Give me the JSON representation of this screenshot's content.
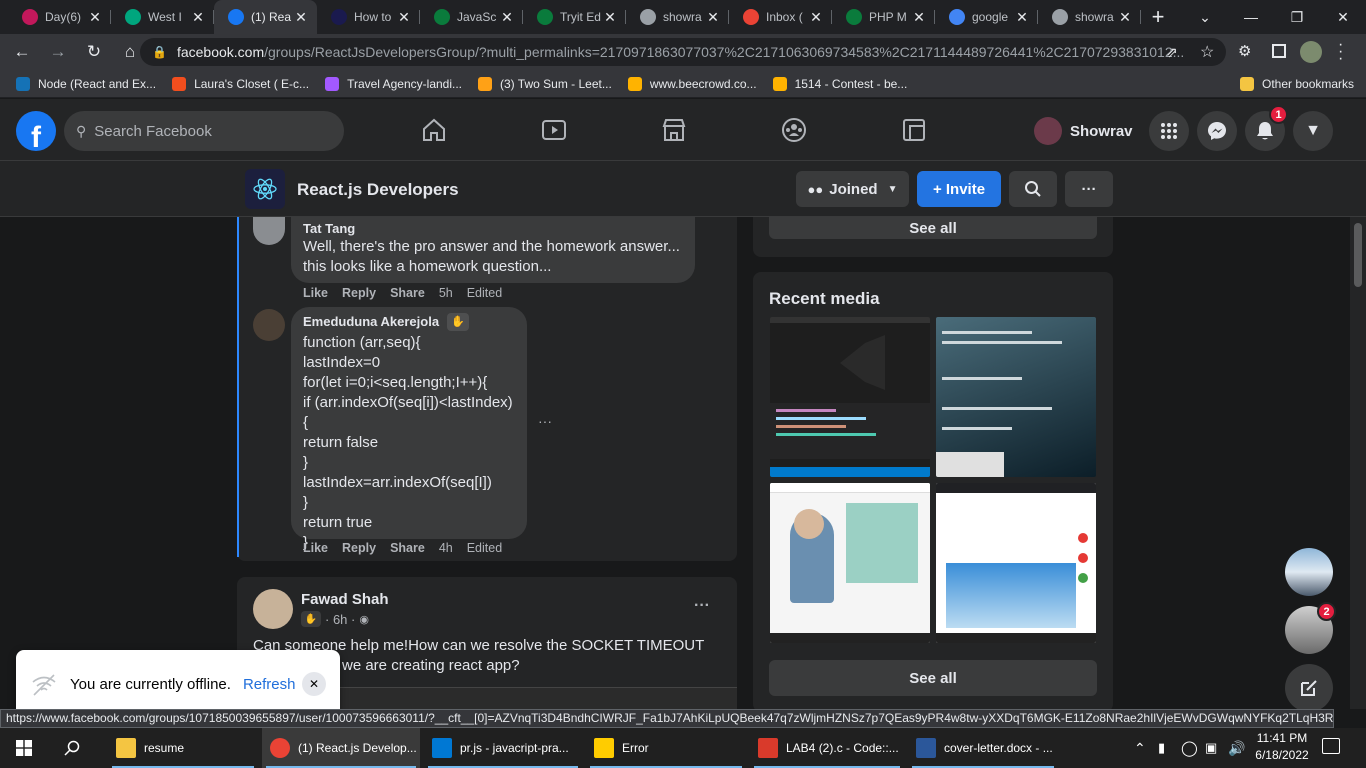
{
  "browser": {
    "tabs": [
      {
        "title": "Day(6)",
        "favicon_color": "#c2185b",
        "active": false
      },
      {
        "title": "West I",
        "favicon_color": "#00a67e",
        "active": false
      },
      {
        "title": "(1) Rea",
        "favicon_color": "#1877f2",
        "active": true
      },
      {
        "title": "How to",
        "favicon_color": "#1a1a4e",
        "active": false
      },
      {
        "title": "JavaSc",
        "favicon_color": "#0a7b3c",
        "active": false
      },
      {
        "title": "Tryit Ed",
        "favicon_color": "#0a7b3c",
        "active": false
      },
      {
        "title": "showra",
        "favicon_color": "#9aa0a6",
        "active": false
      },
      {
        "title": "Inbox (",
        "favicon_color": "#ea4335",
        "active": false
      },
      {
        "title": "PHP M",
        "favicon_color": "#0a7b3c",
        "active": false
      },
      {
        "title": "google",
        "favicon_color": "#4285f4",
        "active": false
      },
      {
        "title": "showra",
        "favicon_color": "#9aa0a6",
        "active": false
      }
    ],
    "url_domain": "facebook.com",
    "url_path": "/groups/ReactJsDevelopersGroup/?multi_permalinks=2170971863077037%2C2171063069734583%2C2171144489726441%2C21707293831012...",
    "bookmarks": [
      {
        "label": "Node (React and Ex...",
        "color": "#1572b6"
      },
      {
        "label": "Laura's Closet ( E-c...",
        "color": "#f24e1e"
      },
      {
        "label": "Travel Agency-landi...",
        "color": "#a259ff"
      },
      {
        "label": "(3) Two Sum - Leet...",
        "color": "#ffa116"
      },
      {
        "label": "www.beecrowd.co...",
        "color": "#ffb300"
      },
      {
        "label": "1514 - Contest - be...",
        "color": "#ffb300"
      }
    ],
    "other_bookmarks": "Other bookmarks"
  },
  "facebook": {
    "search_placeholder": "Search Facebook",
    "user_name": "Showrav",
    "notification_count": "1",
    "group": {
      "name": "React.js Developers",
      "joined_label": "Joined",
      "invite_label": "+ Invite"
    }
  },
  "comments": [
    {
      "author": "Tat Tang",
      "lines": [
        "Well, there's the pro answer and the homework answer...",
        "this looks like a homework question..."
      ],
      "actions": [
        "Like",
        "Reply",
        "Share"
      ],
      "time": "5h",
      "edited": "Edited"
    },
    {
      "author": "Emeduduna Akerejola",
      "lines": [
        "function (arr,seq){",
        "lastIndex=0",
        "for(let i=0;i<seq.length;I++){",
        "if (arr.indexOf(seq[i])<lastIndex){",
        "return false",
        "}",
        "lastIndex=arr.indexOf(seq[I])",
        "}",
        "return true",
        "}"
      ],
      "actions": [
        "Like",
        "Reply",
        "Share"
      ],
      "time": "4h",
      "edited": "Edited"
    }
  ],
  "post": {
    "author": "Fawad Shah",
    "time": "· 6h ·",
    "text_line1": "Can someone help me!How can we resolve the SOCKET TIMEOUT",
    "text_line2": "we are creating react app?",
    "menu_glyph": "···"
  },
  "sidebar": {
    "see_all_top": "See all",
    "recent_media_title": "Recent media",
    "see_all_bottom": "See all"
  },
  "offline_toast": {
    "message": "You are currently offline.",
    "action": "Refresh"
  },
  "chat_heads": {
    "badge": "2"
  },
  "status_url": "https://www.facebook.com/groups/1071850039655897/user/100073596663011/?__cft__[0]=AZVnqTi3D4BndhCIWRJF_Fa1bJ7AhKiLpUQBeek47q7zWljmHZNSz7p7QEas9yPR4w8tw-yXXDqT6MGK-E11Zo8NRae2hIlVjeEWvDGWqwNYFKq2TLqH3RiqEpIQ...",
  "taskbar": {
    "apps": [
      {
        "label": "resume",
        "icon": "folder-icon",
        "color": "#f4c542"
      },
      {
        "label": "(1) React.js Develop...",
        "icon": "chrome-icon",
        "color": "#ea4335"
      },
      {
        "label": "pr.js - javacript-pra...",
        "icon": "vscode-icon",
        "color": "#0078d4"
      },
      {
        "label": "Error",
        "icon": "warning-icon",
        "color": "#ffcc00"
      },
      {
        "label": "LAB4 (2).c - Code::...",
        "icon": "codeblocks-icon",
        "color": "#d93a2b"
      },
      {
        "label": "cover-letter.docx - ...",
        "icon": "word-icon",
        "color": "#2b579a"
      }
    ],
    "time": "11:41 PM",
    "date": "6/18/2022"
  }
}
